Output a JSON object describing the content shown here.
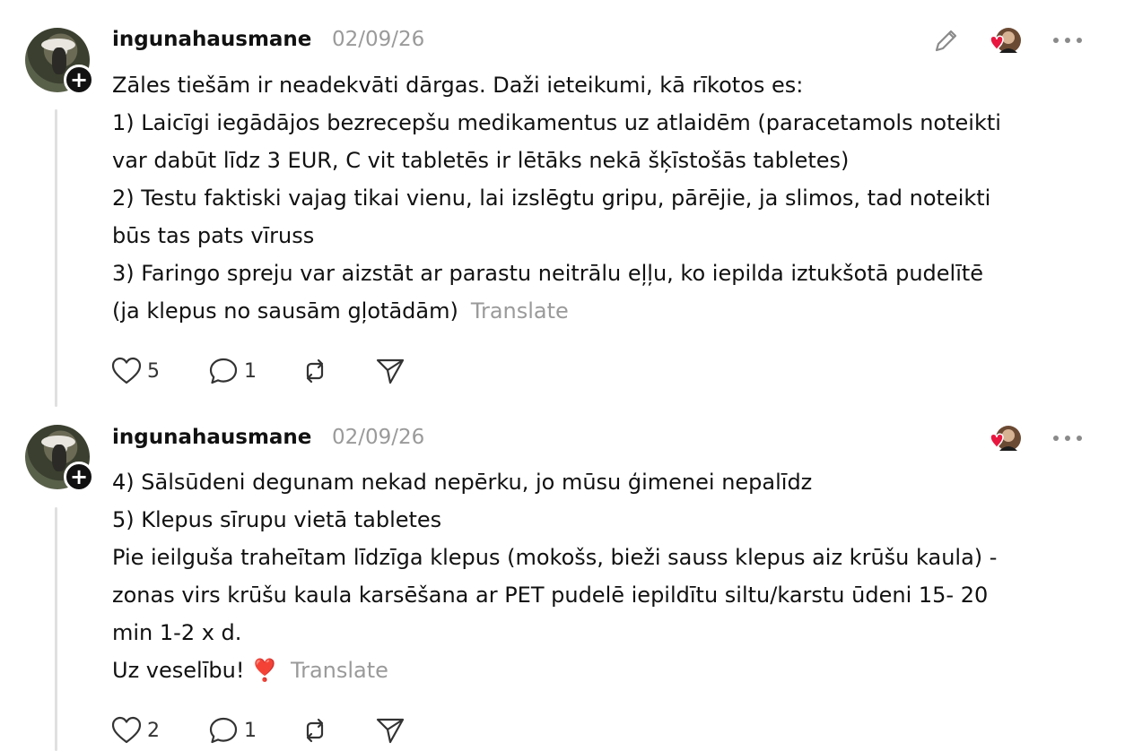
{
  "posts": [
    {
      "username": "ingunahausmane",
      "date": "02/09/26",
      "lines": [
        "Zāles tiešām ir neadekvāti dārgas. Daži ieteikumi, kā rīkotos es:",
        "1) Laicīgi iegādājos bezrecepšu medikamentus uz atlaidēm (paracetamols noteikti",
        "var dabūt līdz 3 EUR, C vit tabletēs ir lētāks nekā šķīstošās tabletes)",
        "2) Testu faktiski vajag tikai vienu, lai izslēgtu gripu, pārējie, ja slimos, tad noteikti",
        "būs tas pats vīruss",
        "3) Faringo spreju var aizstāt ar parastu neitrālu eļļu, ko iepilda iztukšotā pudelītē",
        "(ja klepus no sausām gļotādām)"
      ],
      "translate_label": "Translate",
      "likes": "5",
      "replies": "1",
      "has_edit": true
    },
    {
      "username": "ingunahausmane",
      "date": "02/09/26",
      "lines": [
        "4) Sālsūdeni degunam nekad nepērku, jo mūsu ģimenei nepalīdz",
        "5) Klepus sīrupu vietā tabletes",
        "Pie ieilguša traheītam līdzīga klepus (mokošs, bieži sauss klepus aiz krūšu kaula) -",
        "zonas virs krūšu kaula karsēšana ar PET pudelē iepildītu siltu/karstu ūdeni 15- 20",
        "min 1-2 x d.",
        "Uz veselību! ❣️"
      ],
      "translate_label": "Translate",
      "likes": "2",
      "replies": "1",
      "has_edit": false
    }
  ],
  "icons": {
    "like": "heart-outline-icon",
    "reply": "speech-bubble-icon",
    "repost": "repost-icon",
    "share": "paper-plane-icon",
    "edit": "pencil-icon",
    "more": "more-horizontal-icon",
    "follow": "plus-icon"
  },
  "colors": {
    "text": "#111111",
    "muted": "#9a9a9a",
    "thread_line": "#e0e0e0",
    "like_heart": "#e8173f"
  }
}
